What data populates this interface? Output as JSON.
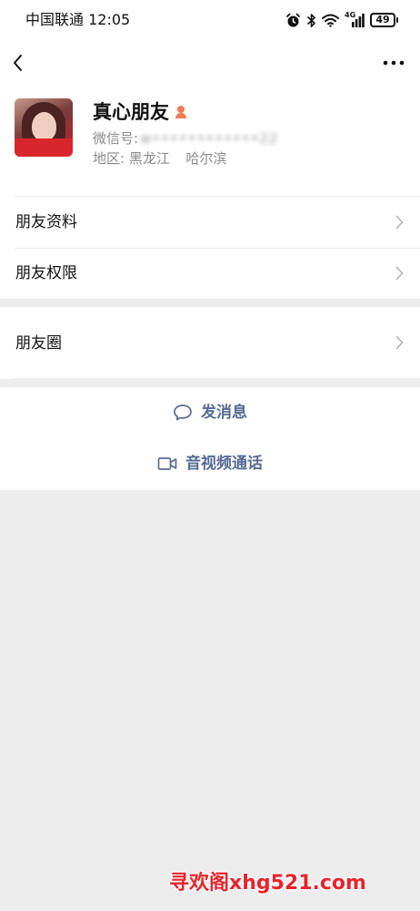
{
  "status_bar": {
    "carrier": "中国联通",
    "time": "12:05",
    "network": "4G",
    "battery": "49"
  },
  "profile": {
    "display_name": "真心朋友",
    "wechat_id_label": "微信号:",
    "wechat_id_value": "w••••••••••••22",
    "region_label": "地区:",
    "province": "黑龙江",
    "city": "哈尔滨"
  },
  "menu": {
    "friend_info": "朋友资料",
    "friend_permissions": "朋友权限",
    "moments": "朋友圈"
  },
  "actions": {
    "send_message": "发消息",
    "video_call": "音视频通话"
  },
  "colors": {
    "link_blue": "#576b95",
    "background_gray": "#ededed",
    "gender_icon": "#f37b52",
    "watermark_red": "#e8242c"
  },
  "watermark": "寻欢阁xhg521.com"
}
